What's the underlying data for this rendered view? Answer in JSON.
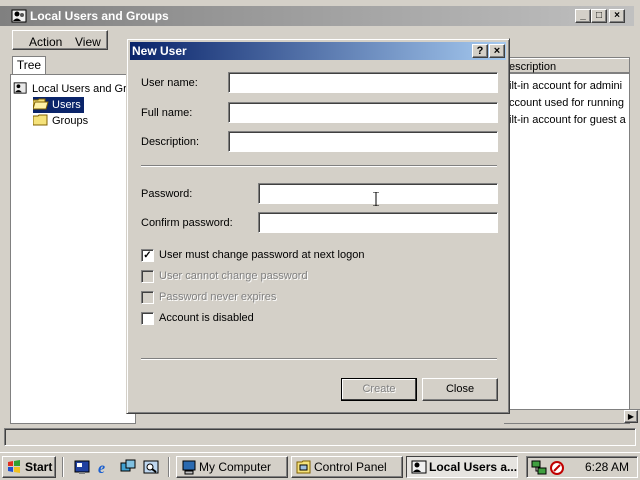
{
  "main_window": {
    "title": "Local Users and Groups",
    "menu": {
      "action": "Action",
      "view": "View"
    },
    "tree_tab": "Tree",
    "tree": {
      "root": "Local Users and Grou",
      "users": "Users",
      "groups": "Groups"
    },
    "list": {
      "header": "escription",
      "rows": [
        "ilt-in account for admini",
        "ccount used for running",
        "ilt-in account for guest a"
      ]
    }
  },
  "dialog": {
    "title": "New User",
    "help_label": "?",
    "close_label": "×",
    "fields": {
      "user_name_label": "User name:",
      "user_name_value": "",
      "full_name_label": "Full name:",
      "full_name_value": "",
      "description_label": "Description:",
      "description_value": "",
      "password_label": "Password:",
      "password_value": "",
      "confirm_label": "Confirm password:",
      "confirm_value": ""
    },
    "checks": [
      {
        "label": "User must change password at next logon",
        "checked": true,
        "enabled": true
      },
      {
        "label": "User cannot change password",
        "checked": false,
        "enabled": false
      },
      {
        "label": "Password never expires",
        "checked": false,
        "enabled": false
      },
      {
        "label": "Account is disabled",
        "checked": false,
        "enabled": true
      }
    ],
    "buttons": {
      "create": "Create",
      "close": "Close"
    }
  },
  "taskbar": {
    "start_label": "Start",
    "tasks": [
      {
        "label": "My Computer"
      },
      {
        "label": "Control Panel"
      },
      {
        "label": "Local Users a..."
      }
    ],
    "clock": "6:28 AM"
  },
  "colors": {
    "dialog_title_start": "#0a246a",
    "dialog_title_end": "#a6caf0",
    "inactive_title": "#808080",
    "face": "#d4d0c8"
  }
}
